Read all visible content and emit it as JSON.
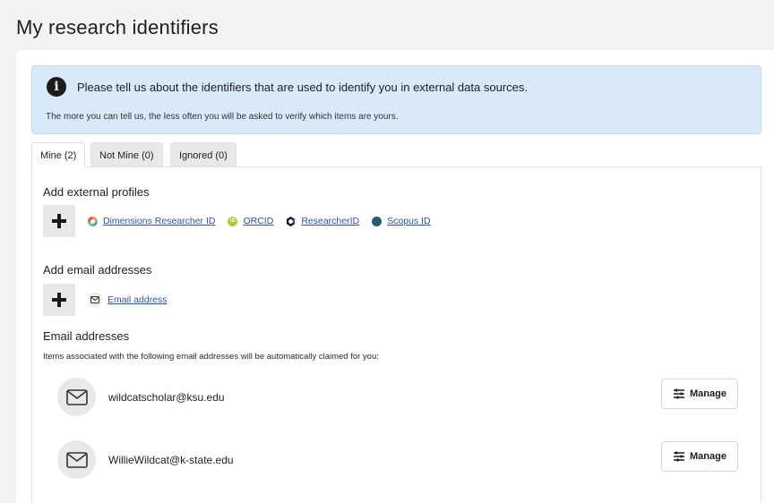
{
  "page": {
    "title": "My research identifiers"
  },
  "info": {
    "main": "Please tell us about the identifiers that are used to identify you in external data sources.",
    "sub": "The more you can tell us, the less often you will be asked to verify which items are yours.",
    "icon": "info-icon"
  },
  "tabs": [
    {
      "label": "Mine (2)",
      "active": true
    },
    {
      "label": "Not Mine (0)",
      "active": false
    },
    {
      "label": "Ignored (0)",
      "active": false
    }
  ],
  "external_profiles": {
    "heading": "Add external profiles",
    "links": [
      {
        "label": "Dimensions Researcher ID",
        "icon": "dimensions-icon"
      },
      {
        "label": "ORCID",
        "icon": "orcid-icon"
      },
      {
        "label": "ResearcherID",
        "icon": "researcherid-icon"
      },
      {
        "label": "Scopus ID",
        "icon": "scopus-icon"
      }
    ]
  },
  "add_email": {
    "heading": "Add email addresses",
    "link_label": "Email address"
  },
  "email_addresses": {
    "heading": "Email addresses",
    "helper": "Items associated with the following email addresses will be automatically claimed for you:",
    "items": [
      {
        "email": "wildcatscholar@ksu.edu",
        "action": "Manage"
      },
      {
        "email": "WillieWildcat@k-state.edu",
        "action": "Manage"
      }
    ]
  },
  "colors": {
    "info_bg": "#d8e9fa",
    "link": "#2b56a8",
    "orcid": "#a6ce39",
    "scopus": "#1f5f6e"
  }
}
